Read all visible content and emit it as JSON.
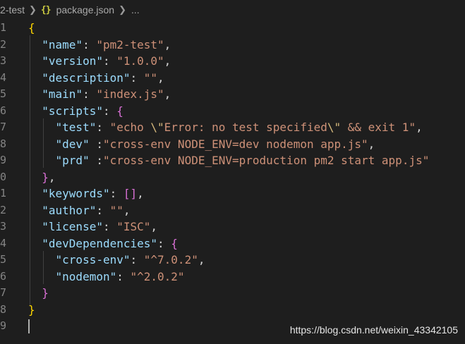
{
  "breadcrumb": {
    "folder": "2-test",
    "file_icon": "{}",
    "file": "package.json",
    "more": "..."
  },
  "editor": {
    "line_numbers": [
      "1",
      "2",
      "3",
      "4",
      "5",
      "6",
      "7",
      "8",
      "9",
      "0",
      "1",
      "2",
      "3",
      "4",
      "5",
      "6",
      "7",
      "8",
      "9"
    ],
    "lines": [
      [
        [
          "b",
          "{"
        ]
      ],
      [
        [
          "p",
          "  "
        ],
        [
          "k",
          "\"name\""
        ],
        [
          "p",
          ": "
        ],
        [
          "s",
          "\"pm2-test\""
        ],
        [
          "p",
          ","
        ]
      ],
      [
        [
          "p",
          "  "
        ],
        [
          "k",
          "\"version\""
        ],
        [
          "p",
          ": "
        ],
        [
          "s",
          "\"1.0.0\""
        ],
        [
          "p",
          ","
        ]
      ],
      [
        [
          "p",
          "  "
        ],
        [
          "k",
          "\"description\""
        ],
        [
          "p",
          ": "
        ],
        [
          "s",
          "\"\""
        ],
        [
          "p",
          ","
        ]
      ],
      [
        [
          "p",
          "  "
        ],
        [
          "k",
          "\"main\""
        ],
        [
          "p",
          ": "
        ],
        [
          "s",
          "\"index.js\""
        ],
        [
          "p",
          ","
        ]
      ],
      [
        [
          "p",
          "  "
        ],
        [
          "k",
          "\"scripts\""
        ],
        [
          "p",
          ": "
        ],
        [
          "b2",
          "{"
        ]
      ],
      [
        [
          "p",
          "    "
        ],
        [
          "k",
          "\"test\""
        ],
        [
          "p",
          ": "
        ],
        [
          "s",
          "\"echo "
        ],
        [
          "e",
          "\\\""
        ],
        [
          "s",
          "Error: no test specified"
        ],
        [
          "e",
          "\\\""
        ],
        [
          "s",
          " && exit 1\""
        ],
        [
          "p",
          ","
        ]
      ],
      [
        [
          "p",
          "    "
        ],
        [
          "k",
          "\"dev\""
        ],
        [
          "p",
          " :"
        ],
        [
          "s",
          "\"cross-env NODE_ENV=dev nodemon app.js\""
        ],
        [
          "p",
          ","
        ]
      ],
      [
        [
          "p",
          "    "
        ],
        [
          "k",
          "\"prd\""
        ],
        [
          "p",
          " :"
        ],
        [
          "s",
          "\"cross-env NODE_ENV=production pm2 start app.js\""
        ]
      ],
      [
        [
          "p",
          "  "
        ],
        [
          "b2",
          "}"
        ],
        [
          "p",
          ","
        ]
      ],
      [
        [
          "p",
          "  "
        ],
        [
          "k",
          "\"keywords\""
        ],
        [
          "p",
          ": "
        ],
        [
          "b2",
          "["
        ],
        [
          "b2",
          "]"
        ],
        [
          "p",
          ","
        ]
      ],
      [
        [
          "p",
          "  "
        ],
        [
          "k",
          "\"author\""
        ],
        [
          "p",
          ": "
        ],
        [
          "s",
          "\"\""
        ],
        [
          "p",
          ","
        ]
      ],
      [
        [
          "p",
          "  "
        ],
        [
          "k",
          "\"license\""
        ],
        [
          "p",
          ": "
        ],
        [
          "s",
          "\"ISC\""
        ],
        [
          "p",
          ","
        ]
      ],
      [
        [
          "p",
          "  "
        ],
        [
          "k",
          "\"devDependencies\""
        ],
        [
          "p",
          ": "
        ],
        [
          "b2",
          "{"
        ]
      ],
      [
        [
          "p",
          "    "
        ],
        [
          "k",
          "\"cross-env\""
        ],
        [
          "p",
          ": "
        ],
        [
          "s",
          "\"^7.0.2\""
        ],
        [
          "p",
          ","
        ]
      ],
      [
        [
          "p",
          "    "
        ],
        [
          "k",
          "\"nodemon\""
        ],
        [
          "p",
          ": "
        ],
        [
          "s",
          "\"^2.0.2\""
        ]
      ],
      [
        [
          "p",
          "  "
        ],
        [
          "b2",
          "}"
        ]
      ],
      [
        [
          "b",
          "}"
        ]
      ],
      []
    ]
  },
  "watermark": "https://blog.csdn.net/weixin_43342105",
  "colors": {
    "background": "#1e1e1e",
    "key": "#9cdcfe",
    "string": "#ce9178",
    "escape": "#d7ba7d",
    "bracket_outer": "#ffd700",
    "bracket_inner": "#da70d6",
    "line_number": "#858585"
  }
}
